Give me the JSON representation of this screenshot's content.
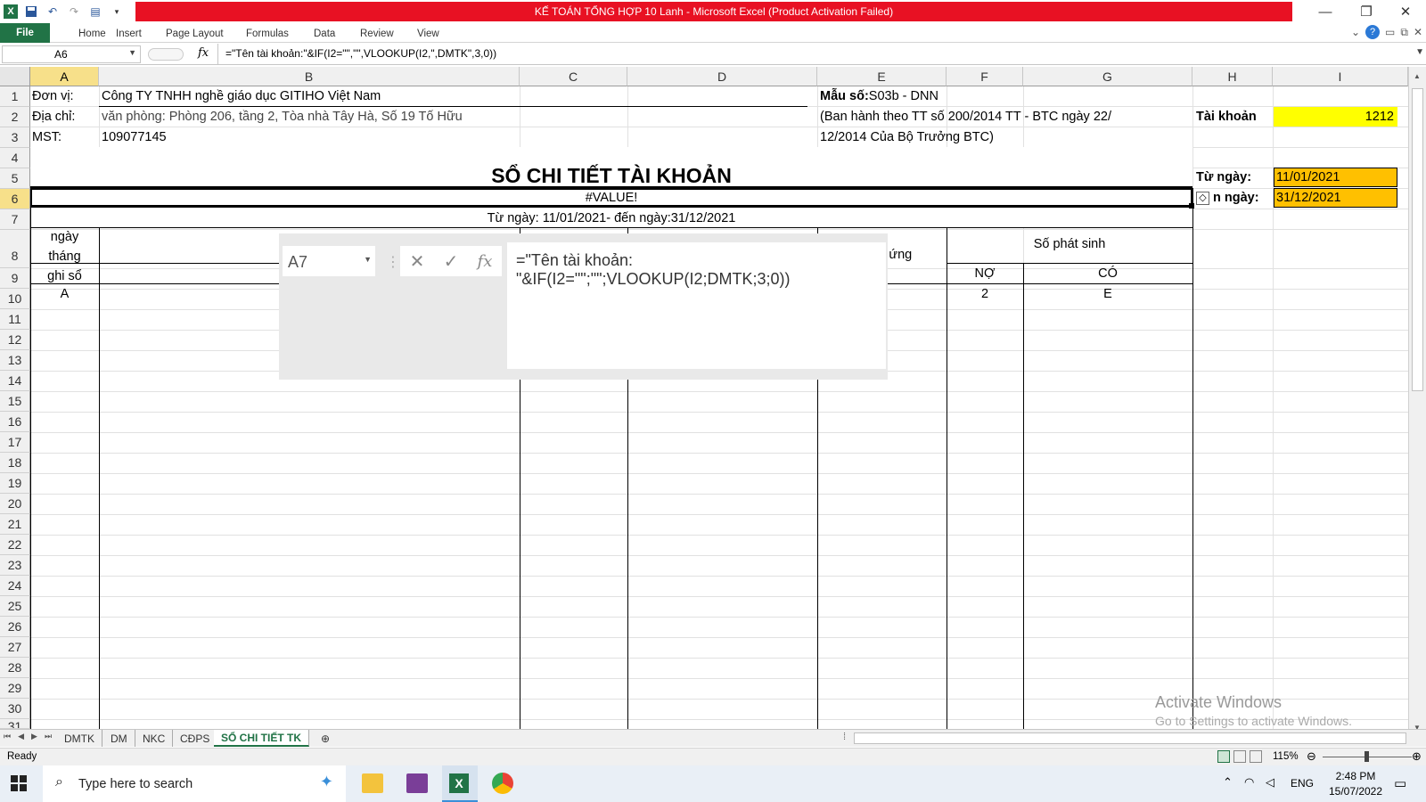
{
  "app": {
    "title": "KẾ TOÁN TỔNG HỢP 10 Lanh  -  Microsoft Excel (Product Activation Failed)",
    "window_controls": [
      "?",
      "⊡",
      "✕"
    ]
  },
  "ribbon": {
    "file": "File",
    "tabs": [
      "Home",
      "Insert",
      "Page Layout",
      "Formulas",
      "Data",
      "Review",
      "View"
    ]
  },
  "formula_bar": {
    "name_box": "A6",
    "fx": "fx",
    "formula": "=\"Tên tài khoản:\"&IF(I2=\"\",\"\",VLOOKUP(I2,\",DMTK\",3,0))"
  },
  "columns": [
    "A",
    "B",
    "C",
    "D",
    "E",
    "F",
    "G",
    "H",
    "I"
  ],
  "rows": [
    "1",
    "2",
    "3",
    "4",
    "5",
    "6",
    "7",
    "8",
    "9",
    "10",
    "11",
    "12",
    "13",
    "14",
    "15",
    "16",
    "17",
    "18",
    "19",
    "20",
    "21",
    "22",
    "23",
    "24",
    "25",
    "26",
    "27",
    "28",
    "29",
    "30",
    "31"
  ],
  "cells": {
    "A1": "Đơn vị:",
    "B1": "Công TY TNHH nghề giáo dục GITIHO Việt Nam",
    "E1_bold": "Mẫu số:",
    "E1": " S03b - DNN",
    "A2": "Địa chỉ:",
    "B2": "văn phòng: Phòng 206, tầng 2, Tòa nhà Tây Hà, Số 19 Tố Hữu",
    "E2": "(Ban hành theo TT số 200/2014 TT - BTC ngày 22/",
    "H2": "Tài khoản",
    "I2": "1212",
    "A3": "MST:",
    "B3": "109077145",
    "E3": " 12/2014 Của Bộ Trưởng BTC)",
    "title": "SỔ CHI TIẾT TÀI KHOẢN",
    "H5": "Từ ngày:",
    "I5": "11/01/2021",
    "A6": "#VALUE!",
    "H6": "n ngày:",
    "I6": "31/12/2021",
    "A7": "Từ ngày: 11/01/2021- đến ngày:31/12/2021",
    "A8": "ngày",
    "A8b": "tháng",
    "A8c": "ghi sổ",
    "E8": "đối ứng",
    "F8": "Số phát sinh",
    "F9": "NỢ",
    "G9": "CÓ",
    "A10": "A",
    "F10": "2",
    "G10": "E"
  },
  "overlay": {
    "name_box": "A7",
    "cancel": "✕",
    "enter": "✓",
    "fx": "fx",
    "formula": "=\"Tên tài khoản: \"&IF(I2=\"\";\"\";VLOOKUP(I2;DMTK;3;0))"
  },
  "sheets": [
    "DMTK",
    "DM",
    "NKC",
    "CĐPS",
    "SỔ CHI TIẾT TK"
  ],
  "active_sheet": "SỔ CHI TIẾT TK",
  "status": {
    "ready": "Ready",
    "zoom": "115%"
  },
  "activate": {
    "line1": "Activate Windows",
    "line2": "Go to Settings to activate Windows."
  },
  "taskbar": {
    "search_placeholder": "Type here to search",
    "lang": "ENG",
    "time": "2:48 PM",
    "date": "15/07/2022"
  },
  "colors": {
    "excel_green": "#217346",
    "title_red": "#e81123",
    "highlight_yellow": "#ffff00",
    "orange_fill": "#ffc000",
    "header_selected": "#f7e08a"
  }
}
